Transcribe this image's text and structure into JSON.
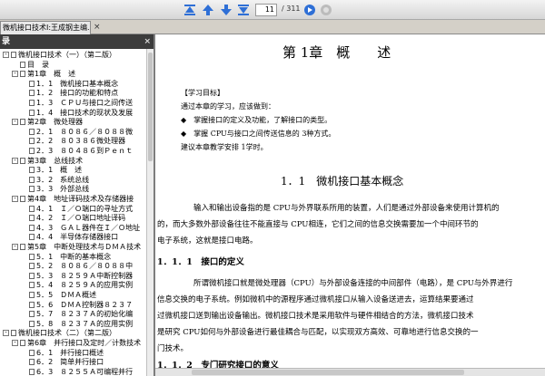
{
  "toolbar": {
    "page_current": "11",
    "page_total": "/ 311"
  },
  "tab": {
    "title": "微机接口技术I:王成钢主编.文…",
    "close_symbol": "×"
  },
  "sidebar": {
    "header": "录",
    "close_symbol": "×",
    "items": [
      {
        "text": "微机接口技术（一）（第二版）",
        "toggle": "-"
      },
      {
        "text": "目　录",
        "toggle": ""
      },
      {
        "text": "第1章　概　述",
        "toggle": "-"
      },
      {
        "text": "1．1　微机接口基本概念",
        "toggle": ""
      },
      {
        "text": "1．2　接口的功能和特点",
        "toggle": ""
      },
      {
        "text": "1．3　ＣＰＵ与接口之间传送",
        "toggle": ""
      },
      {
        "text": "1．4　接口技术的现状及发展",
        "toggle": ""
      },
      {
        "text": "第2章　微处理器",
        "toggle": "-"
      },
      {
        "text": "2．1　８０８６／８０８８微",
        "toggle": ""
      },
      {
        "text": "2．2　８０３８６微处理器",
        "toggle": ""
      },
      {
        "text": "2．3　８０４８６到Ｐｅｎｔ",
        "toggle": ""
      },
      {
        "text": "第3章　总线技术",
        "toggle": "-"
      },
      {
        "text": "3．1　概　述",
        "toggle": ""
      },
      {
        "text": "3．2　系统总线",
        "toggle": ""
      },
      {
        "text": "3．3　外部总线",
        "toggle": ""
      },
      {
        "text": "第4章　地址译码技术及存储器接",
        "toggle": "-"
      },
      {
        "text": "4．1　Ｉ／Ｏ端口的寻址方式",
        "toggle": ""
      },
      {
        "text": "4．2　Ｉ／Ｏ端口地址译码",
        "toggle": ""
      },
      {
        "text": "4．3　ＧＡＬ器件在Ｉ／Ｏ地址",
        "toggle": ""
      },
      {
        "text": "4．4　半导体存储器接口",
        "toggle": ""
      },
      {
        "text": "第5章　中断处理技术与ＤＭＡ技术",
        "toggle": "-"
      },
      {
        "text": "5．1　中断的基本概念",
        "toggle": ""
      },
      {
        "text": "5．2　８０８６／８０８８中",
        "toggle": ""
      },
      {
        "text": "5．3　８２５９Ａ中断控制器",
        "toggle": ""
      },
      {
        "text": "5．4　８２５９Ａ的应用实例",
        "toggle": ""
      },
      {
        "text": "5．5　ＤＭＡ概述",
        "toggle": ""
      },
      {
        "text": "5．6　ＤＭＡ控制器８２３７",
        "toggle": ""
      },
      {
        "text": "5．7　８２３７Ａ的初始化编",
        "toggle": ""
      },
      {
        "text": "5．8　８２３７Ａ的应用实例",
        "toggle": ""
      },
      {
        "text": "微机接口技术（二）（第二版）",
        "toggle": "-"
      },
      {
        "text": "第6章　并行接口及定时／计数技术",
        "toggle": "-"
      },
      {
        "text": "6．1　并行接口概述",
        "toggle": ""
      },
      {
        "text": "6．2　简单并行接口",
        "toggle": ""
      },
      {
        "text": "6．3　８２５５Ａ可编程并行",
        "toggle": ""
      }
    ]
  },
  "document": {
    "chapter_title": "第 1章　概　　述",
    "goal_heading": "【学习目标】",
    "goal_intro": "通过本章的学习，应该做到：",
    "goal_items": [
      "掌握接口的定义及功能，了解接口的类型。",
      "掌握 CPU与接口之间传送信息的 3种方式。"
    ],
    "suggest": "建议本章教学安排 1学时。",
    "section_1_1": "1．1　微机接口基本概念",
    "para1": [
      "输入和输出设备指的是 CPU与外界联系所用的装置，人们是通过外部设备来使用计算机的",
      "的，而大多数外部设备往往不能直接与 CPU相连，它们之间的信息交换需要加一个中间环节的",
      "电子系统，这就是接口电路。"
    ],
    "section_1_1_1": "1．1．1　接口的定义",
    "para2": [
      "所谓微机接口就是微处理器（CPU）与外部设备连接的中间部件（电路），是 CPU与外界进行",
      "信息交换的电子系统。例如微机中的源程序通过微机接口从输入设备送进去，运算结果要通过",
      "过微机接口送到输出设备输出。微机接口技术是采用软件与硬件相结合的方法，微机接口技术",
      "是研究 CPU如何与外部设备进行最佳耦合与匹配，以实现双方高效、可靠地进行信息交换的一",
      "门技术。"
    ],
    "section_1_1_2": "1．1．2　专门研究接口的意义"
  }
}
